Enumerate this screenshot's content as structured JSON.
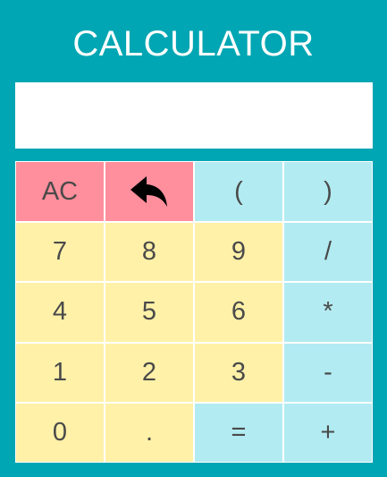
{
  "app": {
    "title": "CALCULATOR"
  },
  "display": {
    "value": ""
  },
  "colors": {
    "background": "#00a6b3",
    "clear_keys": "#ff8f9c",
    "number_keys": "#fff1a8",
    "operator_keys": "#b2ebf2"
  },
  "keys": {
    "clear": "AC",
    "backspace_icon": "undo-arrow-icon",
    "open_paren": "(",
    "close_paren": ")",
    "seven": "7",
    "eight": "8",
    "nine": "9",
    "divide": "/",
    "four": "4",
    "five": "5",
    "six": "6",
    "multiply": "*",
    "one": "1",
    "two": "2",
    "three": "3",
    "subtract": "-",
    "zero": "0",
    "decimal": ".",
    "equals": "=",
    "add": "+"
  }
}
